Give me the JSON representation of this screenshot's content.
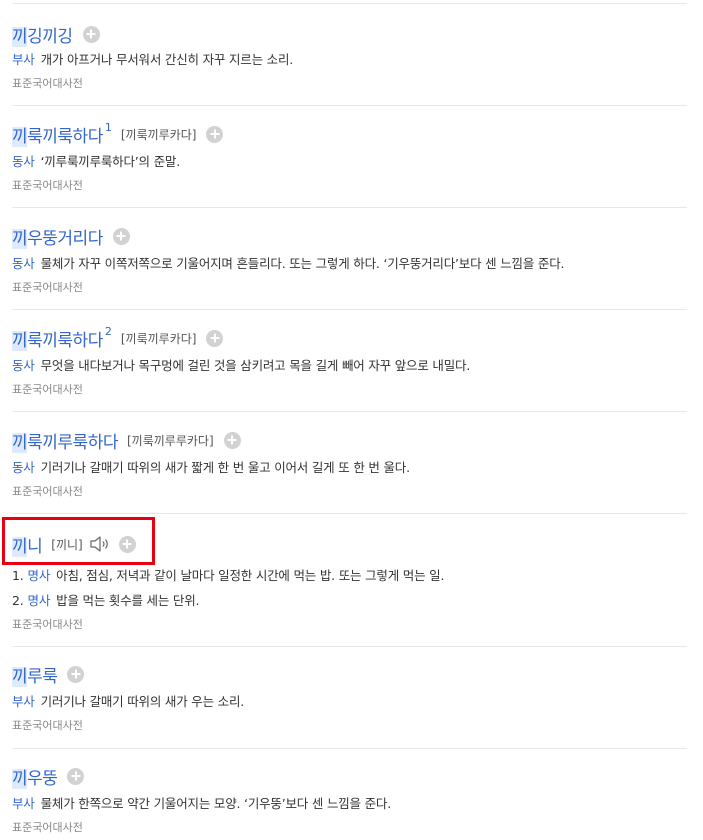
{
  "entries": [
    {
      "word_hl": "끼",
      "word_rest": "깅끼깅",
      "sup": "",
      "pron": "",
      "defs": [
        {
          "num": "",
          "pos": "부사",
          "text": "개가 아프거나 무서워서 간신히 자꾸 지르는 소리."
        }
      ],
      "source": "표준국어대사전"
    },
    {
      "word_hl": "끼",
      "word_rest": "룩끼룩하다",
      "sup": "1",
      "pron": "[끼룩끼루카다]",
      "defs": [
        {
          "num": "",
          "pos": "동사",
          "text": "‘끼루룩끼루룩하다’의 준말."
        }
      ],
      "source": "표준국어대사전"
    },
    {
      "word_hl": "끼",
      "word_rest": "우뚱거리다",
      "sup": "",
      "pron": "",
      "defs": [
        {
          "num": "",
          "pos": "동사",
          "text": "물체가 자꾸 이쪽저쪽으로 기울어지며 흔들리다. 또는 그렇게 하다. ‘기우뚱거리다’보다 센 느낌을 준다."
        }
      ],
      "source": "표준국어대사전"
    },
    {
      "word_hl": "끼",
      "word_rest": "룩끼룩하다",
      "sup": "2",
      "pron": "[끼룩끼루카다]",
      "defs": [
        {
          "num": "",
          "pos": "동사",
          "text": "무엇을 내다보거나 목구멍에 걸린 것을 삼키려고 목을 길게 빼어 자꾸 앞으로 내밀다."
        }
      ],
      "source": "표준국어대사전"
    },
    {
      "word_hl": "끼",
      "word_rest": "룩끼루룩하다",
      "sup": "",
      "pron": "[끼룩끼루루카다]",
      "defs": [
        {
          "num": "",
          "pos": "동사",
          "text": "기러기나 갈매기 따위의 새가 짧게 한 번 울고 이어서 길게 또 한 번 울다."
        }
      ],
      "source": "표준국어대사전"
    },
    {
      "word_hl": "끼",
      "word_rest": "니",
      "sup": "",
      "pron": "[끼니]",
      "defs": [
        {
          "num": "1.",
          "pos": "명사",
          "text": "아침, 점심, 저녁과 같이 날마다 일정한 시간에 먹는 밥. 또는 그렇게 먹는 일."
        },
        {
          "num": "2.",
          "pos": "명사",
          "text": "밥을 먹는 횟수를 세는 단위."
        }
      ],
      "source": "표준국어대사전"
    },
    {
      "word_hl": "끼",
      "word_rest": "루룩",
      "sup": "",
      "pron": "",
      "defs": [
        {
          "num": "",
          "pos": "부사",
          "text": "기러기나 갈매기 따위의 새가 우는 소리."
        }
      ],
      "source": "표준국어대사전"
    },
    {
      "word_hl": "끼",
      "word_rest": "우뚱",
      "sup": "",
      "pron": "",
      "defs": [
        {
          "num": "",
          "pos": "부사",
          "text": "물체가 한쪽으로 약간 기울어지는 모양. ‘기우뚱’보다 센 느낌을 준다."
        }
      ],
      "source": "표준국어대사전"
    }
  ],
  "icons": {
    "add": "plus-circle-icon",
    "speaker": "speaker-icon"
  },
  "colors": {
    "word": "#3366cc",
    "pos": "#3366cc",
    "highlight_bg": "#dfeafc",
    "annotation_box": "#e60012",
    "plus_bg": "#d2d2d2"
  }
}
